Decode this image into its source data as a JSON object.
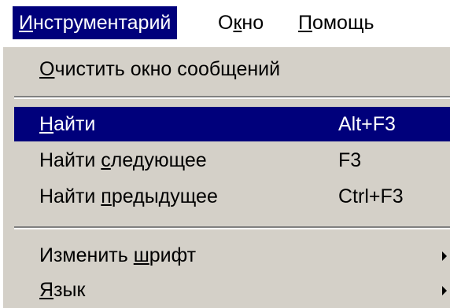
{
  "colors": {
    "highlight": "#00007b",
    "menu_background": "#d4d0c8",
    "menubar_background": "#ffffff",
    "highlight_text": "#ffffff"
  },
  "menubar": {
    "items": [
      {
        "label": "Инструментарий",
        "mnemonic_index": 0,
        "active": true
      },
      {
        "label": "Окно",
        "mnemonic_index": 1,
        "active": false
      },
      {
        "label": "Помощь",
        "mnemonic_index": 0,
        "active": false
      }
    ]
  },
  "dropdown": {
    "items": [
      {
        "type": "item",
        "label": "Очистить окно сообщений",
        "mnemonic_index": 0,
        "shortcut": "",
        "submenu": false,
        "highlighted": false
      },
      {
        "type": "separator"
      },
      {
        "type": "item",
        "label": "Найти",
        "mnemonic_index": 0,
        "shortcut": "Alt+F3",
        "submenu": false,
        "highlighted": true
      },
      {
        "type": "item",
        "label": "Найти следующее",
        "mnemonic_index": 6,
        "shortcut": "F3",
        "submenu": false,
        "highlighted": false
      },
      {
        "type": "item",
        "label": "Найти предыдущее",
        "mnemonic_index": 6,
        "shortcut": "Ctrl+F3",
        "submenu": false,
        "highlighted": false
      },
      {
        "type": "separator"
      },
      {
        "type": "item",
        "label": "Изменить шрифт",
        "mnemonic_index": 9,
        "shortcut": "",
        "submenu": true,
        "highlighted": false
      },
      {
        "type": "item",
        "label": "Язык",
        "mnemonic_index": 0,
        "shortcut": "",
        "submenu": true,
        "highlighted": false
      }
    ]
  }
}
